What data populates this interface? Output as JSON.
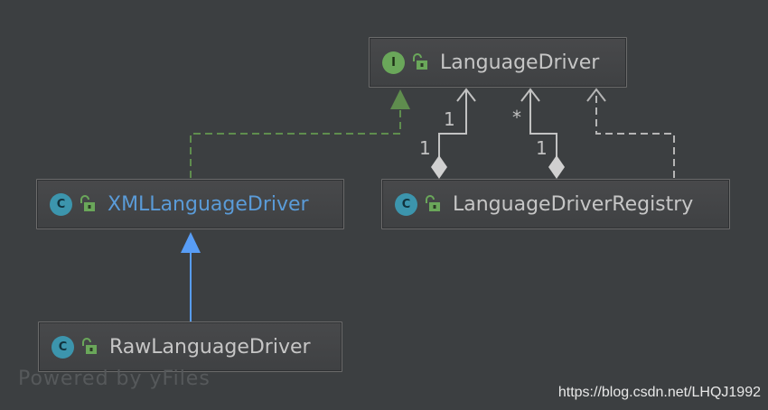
{
  "colors": {
    "background": "#3c3f41",
    "node_text": "#c6c6c6",
    "highlight_text": "#5a9bd8",
    "interface_badge": "#6aa75a",
    "class_badge": "#3c95ad",
    "realization_edge": "#5f8d4e",
    "generalization_edge": "#589df6",
    "association_edge": "#c2c2c2"
  },
  "nodes": {
    "language_driver": {
      "kind_letter": "I",
      "kind_icon": "interface-icon",
      "visibility_icon": "public-unlock-icon",
      "name": "LanguageDriver"
    },
    "xml_language_driver": {
      "kind_letter": "C",
      "kind_icon": "class-icon",
      "visibility_icon": "public-unlock-icon",
      "name": "XMLLanguageDriver"
    },
    "language_driver_registry": {
      "kind_letter": "C",
      "kind_icon": "class-icon",
      "visibility_icon": "public-unlock-icon",
      "name": "LanguageDriverRegistry"
    },
    "raw_language_driver": {
      "kind_letter": "C",
      "kind_icon": "class-icon",
      "visibility_icon": "public-unlock-icon",
      "name": "RawLanguageDriver"
    }
  },
  "edges": {
    "aggregation_one": {
      "target_multiplicity": "1",
      "source_multiplicity": "1"
    },
    "aggregation_many": {
      "target_multiplicity": "*",
      "source_multiplicity": "1"
    }
  },
  "footer": {
    "watermark": "Powered by yFiles",
    "source_url": "https://blog.csdn.net/LHQJ1992"
  }
}
